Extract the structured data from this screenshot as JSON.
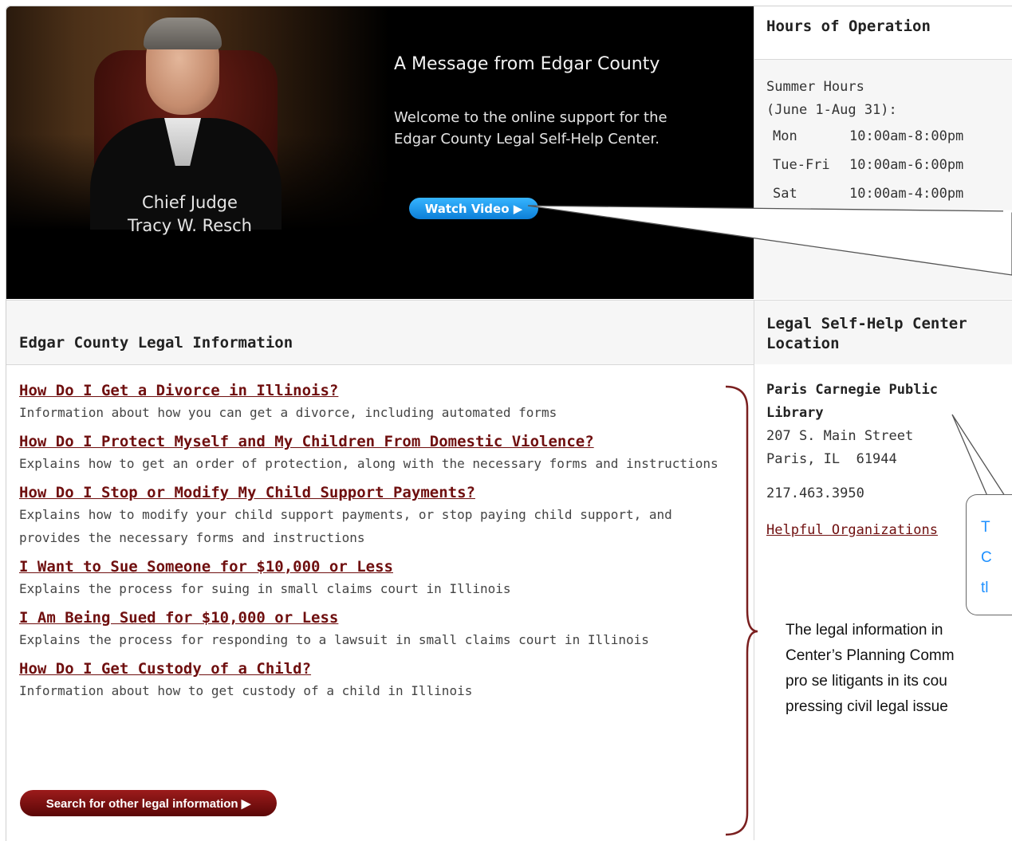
{
  "hero": {
    "judge_title": "Chief Judge",
    "judge_name": "Tracy W. Resch",
    "message_title": "A Message from Edgar County",
    "message_body": "Welcome to the online support for the Edgar County Legal Self-Help Center.",
    "watch_button": "Watch Video ▶"
  },
  "hours": {
    "heading": "Hours of Operation",
    "season_line1": "Summer Hours",
    "season_line2": "(June 1-Aug 31):",
    "rows": [
      {
        "day": "Mon",
        "time": "10:00am-8:00pm"
      },
      {
        "day": "Tue-Fri",
        "time": "10:00am-6:00pm"
      },
      {
        "day": "Sat",
        "time": "10:00am-4:00pm"
      }
    ]
  },
  "legal": {
    "heading": "Edgar County Legal Information",
    "items": [
      {
        "title": "How Do I Get a Divorce in Illinois?",
        "desc": "Information about how you can get a divorce, including automated forms"
      },
      {
        "title": "How Do I Protect Myself and My Children From Domestic Violence?",
        "desc": "Explains how to get an order of protection, along with the necessary forms and instructions"
      },
      {
        "title": "How Do I Stop or Modify My Child Support Payments?",
        "desc": "Explains how to modify your child support payments, or stop paying child support, and provides the necessary forms and instructions"
      },
      {
        "title": "I Want to Sue Someone for $10,000 or Less",
        "desc": "Explains the process for suing in small claims court in Illinois"
      },
      {
        "title": "I Am Being Sued for $10,000 or Less",
        "desc": "Explains the process for responding to a lawsuit in small claims court in Illinois"
      },
      {
        "title": "How Do I Get Custody of a Child?",
        "desc": "Information about how to get custody of a child in Illinois"
      }
    ],
    "search_button": "Search for other legal information ▶"
  },
  "location": {
    "heading": "Legal Self-Help Center Location",
    "name": "Paris Carnegie Public Library",
    "street": "207 S. Main Street",
    "city": "Paris, IL  61944",
    "phone": "217.463.3950",
    "link": "Helpful Organizations"
  },
  "annotations": {
    "callout_lines": [
      "T",
      "C",
      "tl"
    ],
    "note_lines": [
      "The legal information in",
      "Center’s Planning Comm",
      "pro se litigants in its cou",
      "pressing civil legal issue"
    ],
    "callout_color": "#1e90ff",
    "bracket_color": "#7a1f1f"
  },
  "colors": {
    "link": "#6f0f0f",
    "watch_button": "#1a8fe8",
    "search_button": "#7a1010"
  }
}
